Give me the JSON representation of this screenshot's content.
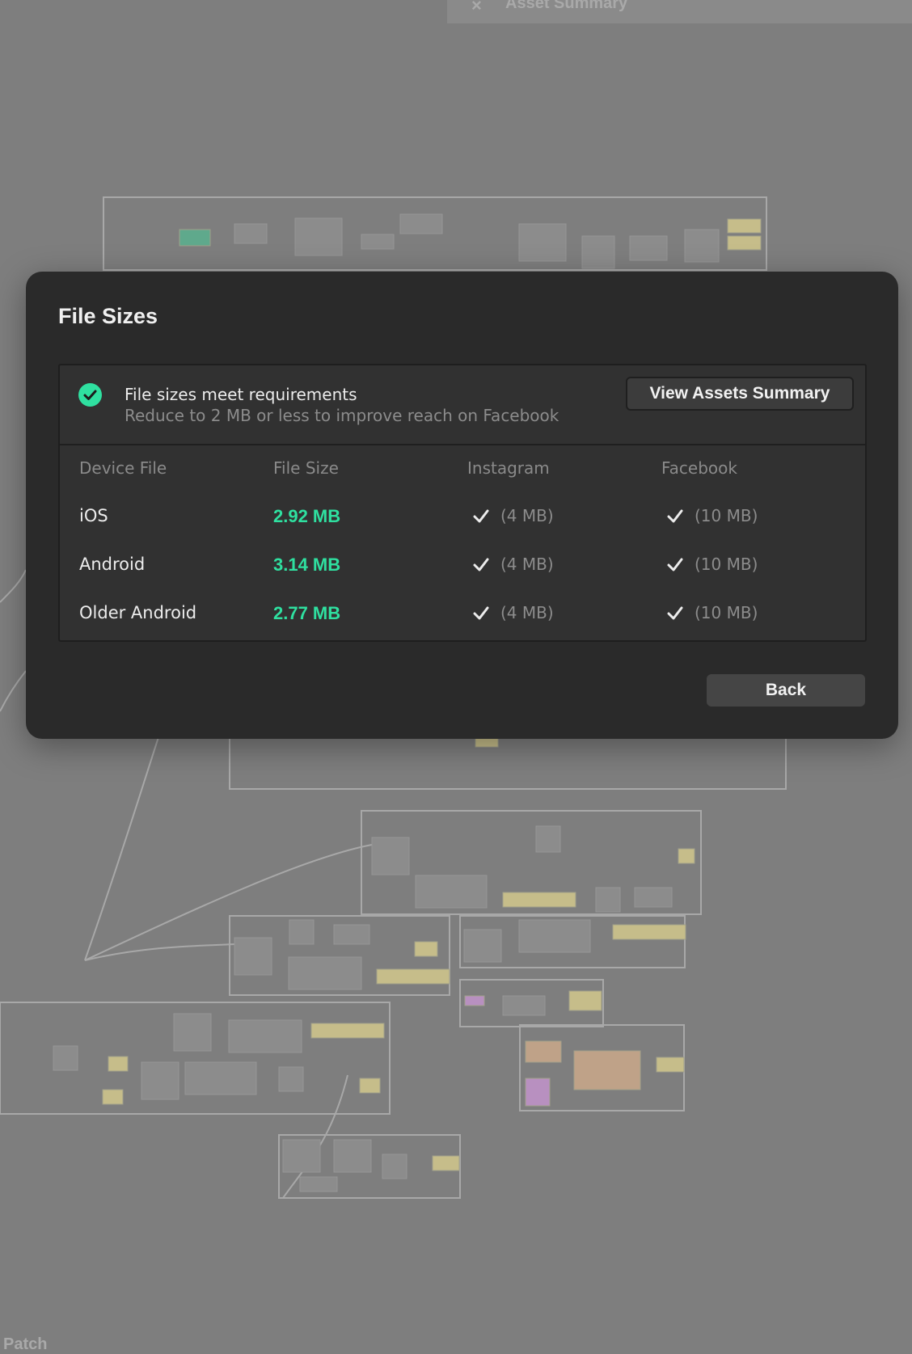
{
  "background": {
    "panel_close_glyph": "×",
    "panel_title": "Asset Summary",
    "bottom_label": "Patch"
  },
  "dialog": {
    "title": "File Sizes",
    "status": {
      "icon": "check-circle-icon",
      "title": "File sizes meet requirements",
      "subtitle": "Reduce to 2 MB or less to improve reach on Facebook",
      "color": "#2fe0a0"
    },
    "view_assets_label": "View Assets Summary",
    "columns": [
      "Device File",
      "File Size",
      "Instagram",
      "Facebook"
    ],
    "rows": [
      {
        "device": "iOS",
        "size": "2.92 MB",
        "instagram": "(4 MB)",
        "facebook": "(10 MB)"
      },
      {
        "device": "Android",
        "size": "3.14 MB",
        "instagram": "(4 MB)",
        "facebook": "(10 MB)"
      },
      {
        "device": "Older Android",
        "size": "2.77 MB",
        "instagram": "(4 MB)",
        "facebook": "(10 MB)"
      }
    ],
    "back_label": "Back"
  }
}
